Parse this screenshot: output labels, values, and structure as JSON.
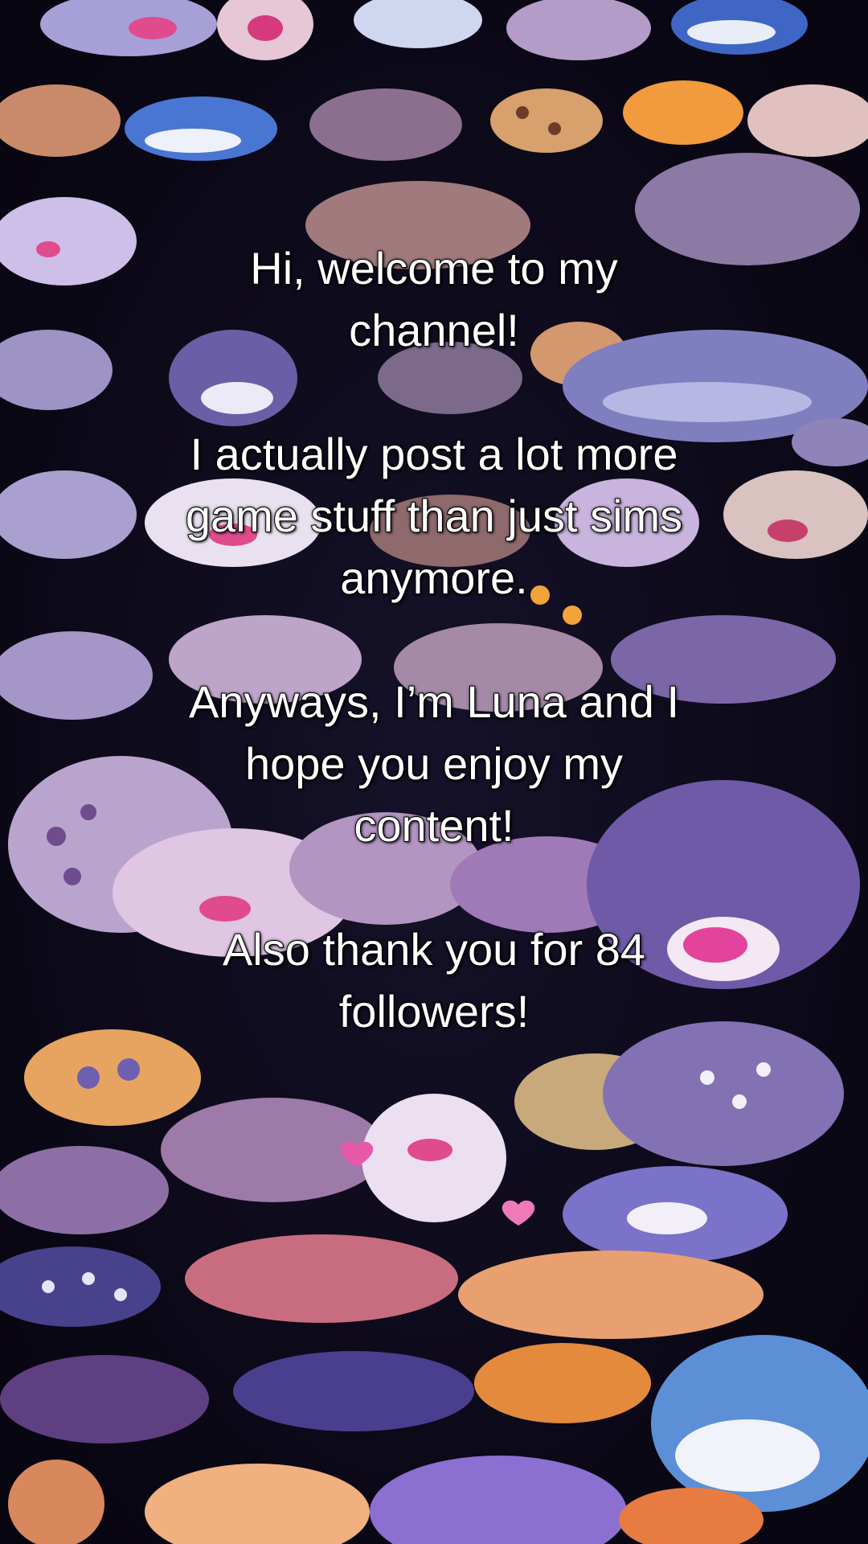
{
  "overlay": {
    "line1": "Hi, welcome to my",
    "line2": "channel!",
    "line3": "I actually post a lot more",
    "line4": "game stuff than just sims",
    "line5": "anymore.",
    "line6": "Anyways, I’m Luna and I",
    "line7": "hope you enjoy my",
    "line8": "content!",
    "line9": "Also thank you for 84",
    "line10": "followers!"
  },
  "background": {
    "description_icons": [
      "shark-icon",
      "ray-icon",
      "heart-icon"
    ],
    "base_color": "#0b0816"
  }
}
